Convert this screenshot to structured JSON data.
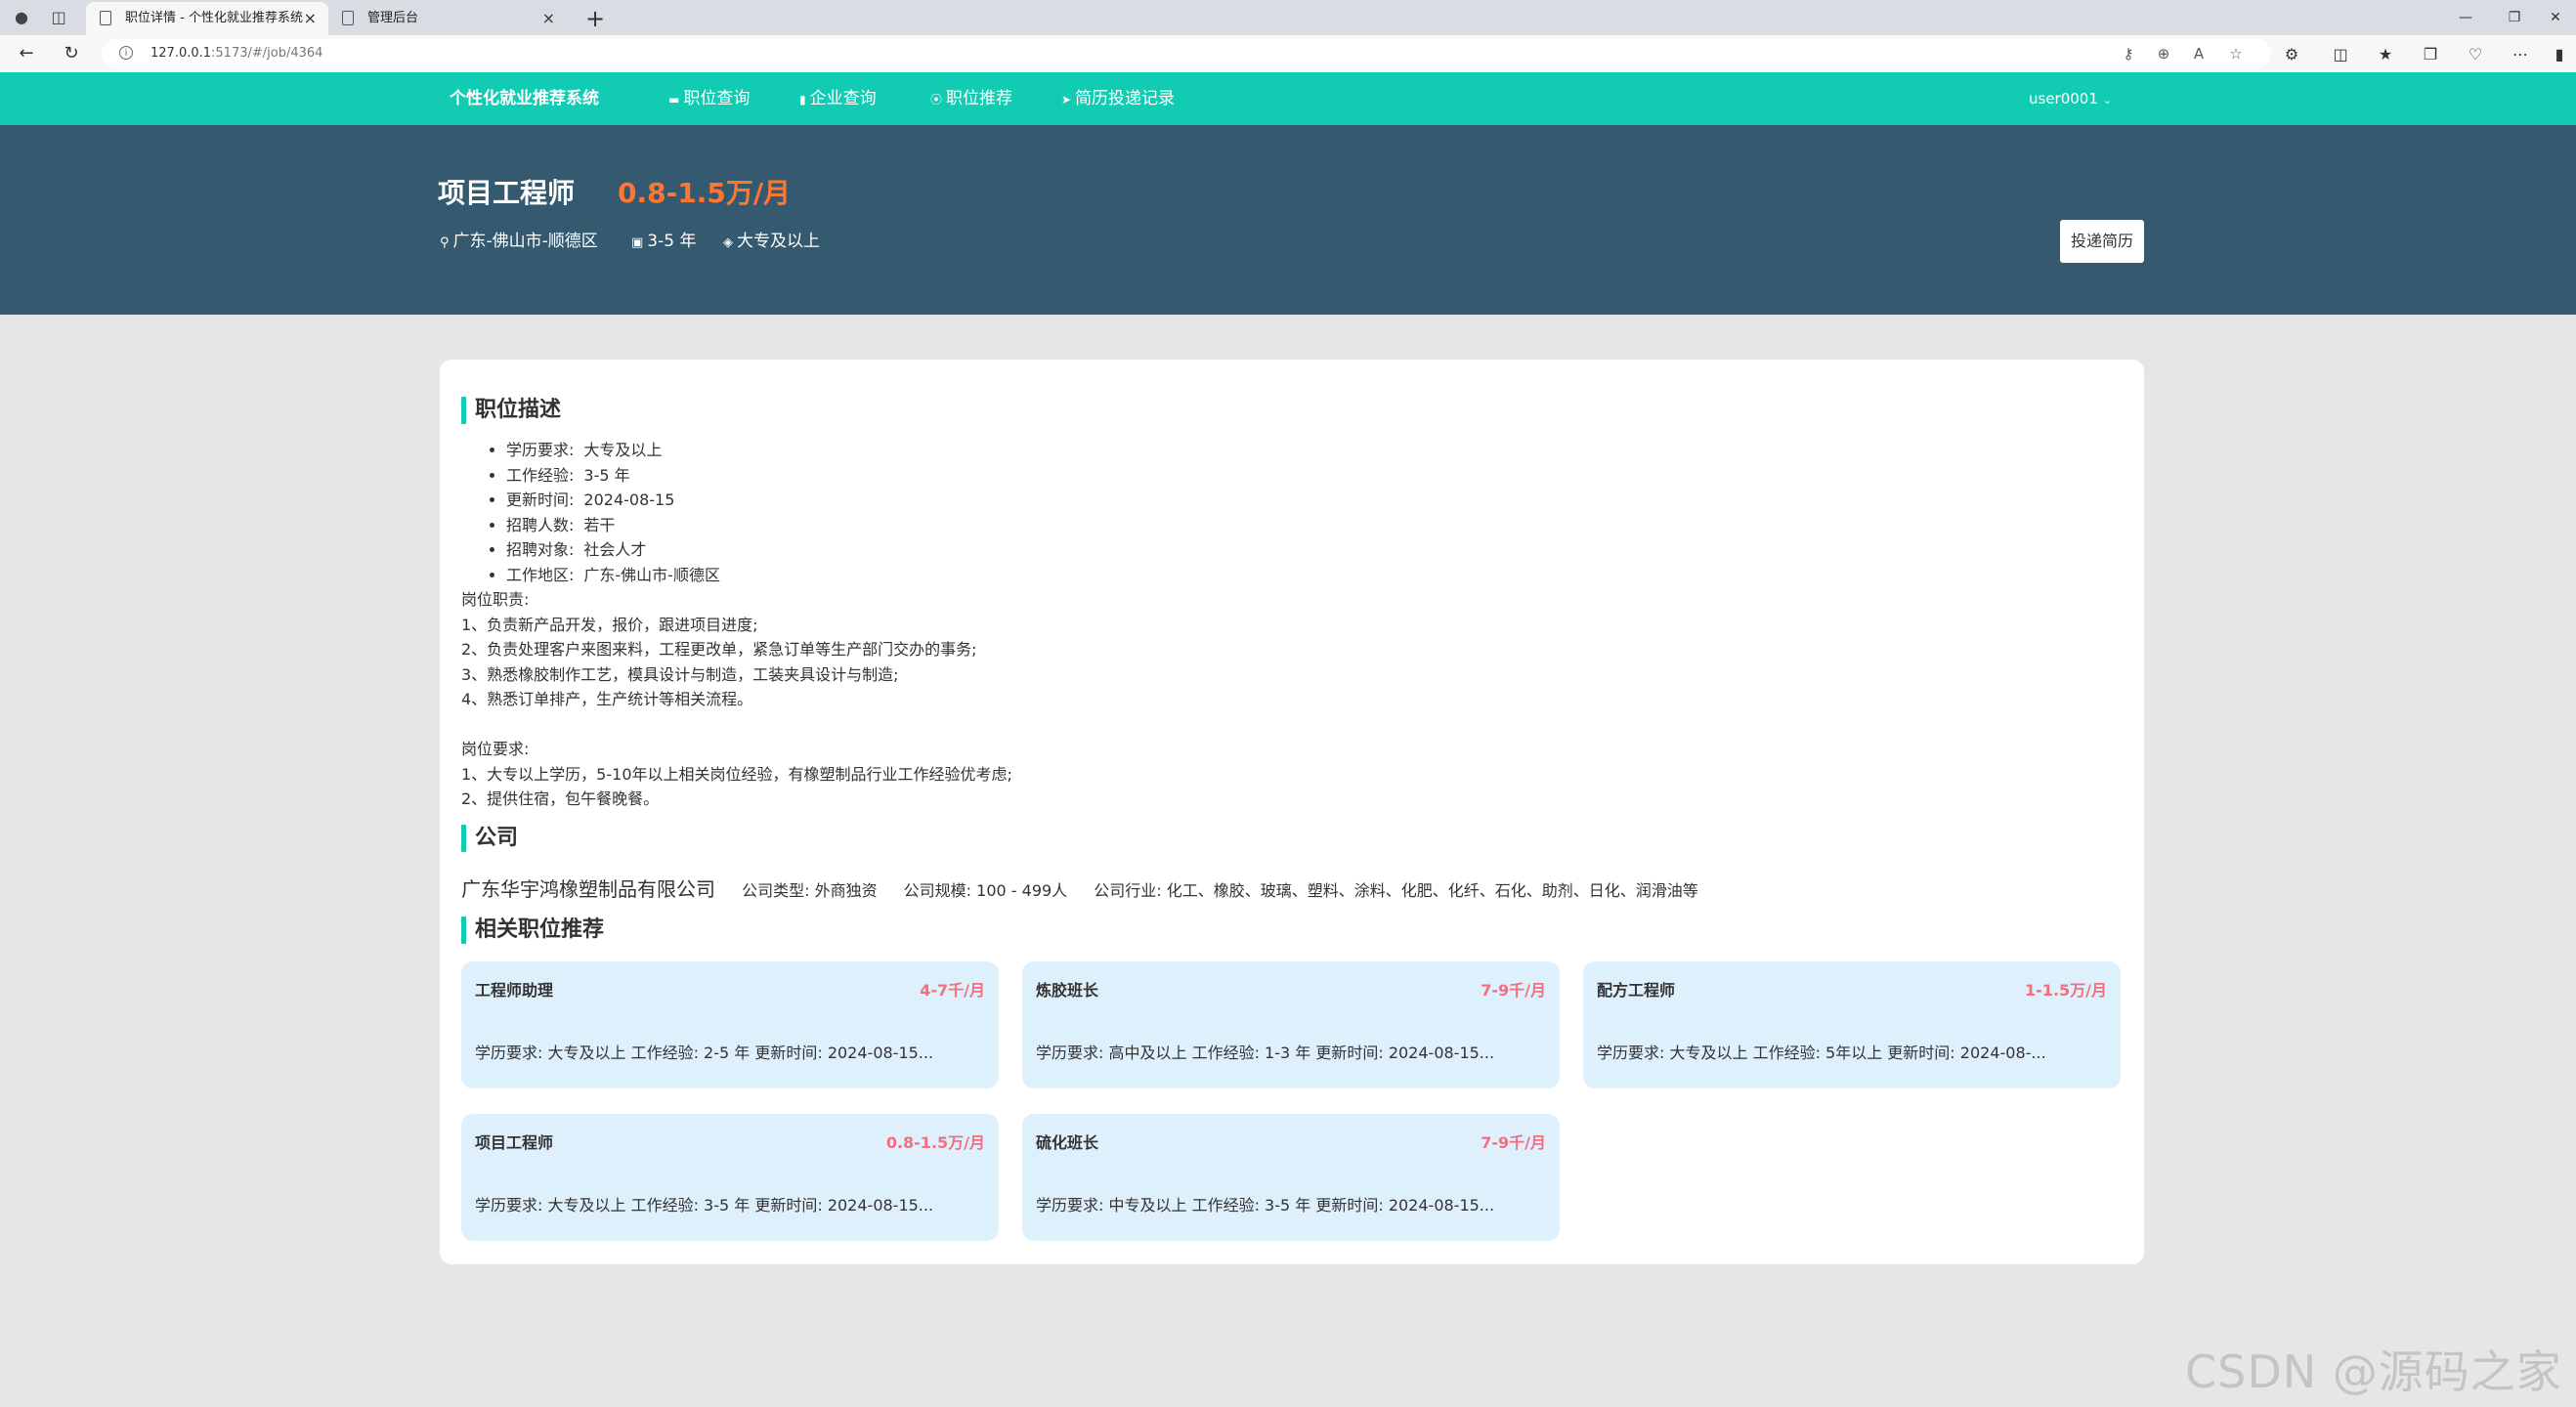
{
  "browser": {
    "tabs": [
      {
        "title": "职位详情 - 个性化就业推荐系统"
      },
      {
        "title": "管理后台"
      }
    ],
    "url_host": "127.0.0.1",
    "url_rest": ":5173/#/job/4364"
  },
  "header": {
    "brand": "个性化就业推荐系统",
    "nav": [
      {
        "label": "职位查询",
        "icon": "briefcase-icon"
      },
      {
        "label": "企业查询",
        "icon": "building-icon"
      },
      {
        "label": "职位推荐",
        "icon": "circle-icon"
      },
      {
        "label": "简历投递记录",
        "icon": "send-icon"
      }
    ],
    "user": "user0001"
  },
  "job": {
    "title": "项目工程师",
    "salary": "0.8-1.5万/月",
    "location": "广东-佛山市-顺德区",
    "experience": "3-5 年",
    "education": "大专及以上",
    "apply_label": "投递简历"
  },
  "sections": {
    "description": "职位描述",
    "company": "公司",
    "related": "相关职位推荐"
  },
  "details": [
    {
      "label": "学历要求:",
      "value": "大专及以上"
    },
    {
      "label": "工作经验:",
      "value": "3-5 年"
    },
    {
      "label": "更新时间:",
      "value": "2024-08-15"
    },
    {
      "label": "招聘人数:",
      "value": "若干"
    },
    {
      "label": "招聘对象:",
      "value": "社会人才"
    },
    {
      "label": "工作地区:",
      "value": "广东-佛山市-顺德区"
    }
  ],
  "description_text": "岗位职责:\n1、负责新产品开发，报价，跟进项目进度;\n2、负责处理客户来图来料，工程更改单，紧急订单等生产部门交办的事务;\n3、熟悉橡胶制作工艺，模具设计与制造，工装夹具设计与制造;\n4、熟悉订单排产，生产统计等相关流程。\n\n岗位要求:\n1、大专以上学历，5-10年以上相关岗位经验，有橡塑制品行业工作经验优考虑;\n2、提供住宿，包午餐晚餐。",
  "company": {
    "name": "广东华宇鸿橡塑制品有限公司",
    "type": "公司类型: 外商独资",
    "size": "公司规模: 100 - 499人",
    "industry": "公司行业: 化工、橡胶、玻璃、塑料、涂料、化肥、化纤、石化、助剂、日化、润滑油等"
  },
  "related": [
    {
      "title": "工程师助理",
      "salary": "4-7千/月",
      "desc": "学历要求:  大专及以上 工作经验:  2-5 年 更新时间:  2024-08-15..."
    },
    {
      "title": "炼胶班长",
      "salary": "7-9千/月",
      "desc": "学历要求:  高中及以上 工作经验:  1-3 年 更新时间:  2024-08-15..."
    },
    {
      "title": "配方工程师",
      "salary": "1-1.5万/月",
      "desc": "学历要求:  大专及以上 工作经验:  5年以上 更新时间:  2024-08-..."
    },
    {
      "title": "项目工程师",
      "salary": "0.8-1.5万/月",
      "desc": "学历要求:  大专及以上 工作经验:  3-5 年 更新时间:  2024-08-15..."
    },
    {
      "title": "硫化班长",
      "salary": "7-9千/月",
      "desc": "学历要求:  中专及以上 工作经验:  3-5 年 更新时间:  2024-08-15..."
    }
  ],
  "watermark": "CSDN @源码之家",
  "colors": {
    "accent": "#11ccb3",
    "hero_bg": "#35596e",
    "salary": "#ff7630",
    "related_salary": "#f07080",
    "related_card_bg": "#dff0fd",
    "page_bg": "#e6e6e6"
  }
}
